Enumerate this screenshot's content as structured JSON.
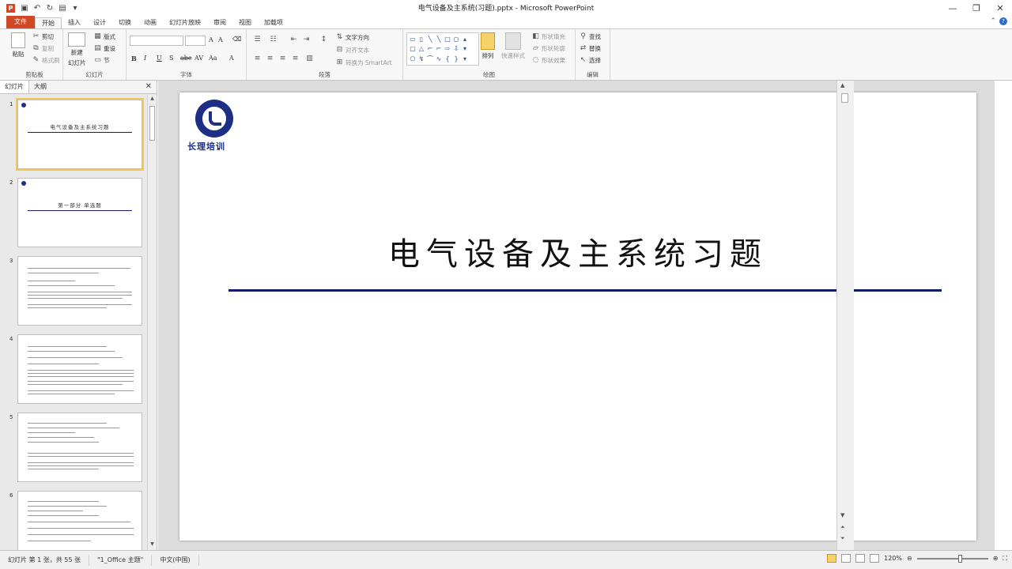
{
  "window": {
    "title": "电气设备及主系统(习题).pptx - Microsoft PowerPoint",
    "app_badge": "P",
    "minimize": "—",
    "restore": "❐",
    "close": "✕"
  },
  "quick_access": [
    "save-icon",
    "undo-icon",
    "redo-icon",
    "new-icon",
    "customize-icon"
  ],
  "tabs": [
    {
      "label": "文件"
    },
    {
      "label": "开始"
    },
    {
      "label": "插入"
    },
    {
      "label": "设计"
    },
    {
      "label": "切换"
    },
    {
      "label": "动画"
    },
    {
      "label": "幻灯片放映"
    },
    {
      "label": "审阅"
    },
    {
      "label": "视图"
    },
    {
      "label": "加载项"
    }
  ],
  "ribbon": {
    "clipboard": {
      "label": "剪贴板",
      "paste": "粘贴",
      "cut": "剪切",
      "copy": "复制",
      "painter": "格式刷"
    },
    "slides": {
      "label": "幻灯片",
      "new_slide": "新建",
      "new_slide2": "幻灯片",
      "layout": "版式",
      "reset": "重设",
      "section": "节"
    },
    "font": {
      "label": "字体",
      "bold": "B",
      "italic": "I",
      "underline": "U",
      "strike": "S",
      "abc": "abc",
      "av": "AV",
      "aa": "Aa",
      "a": "A"
    },
    "paragraph": {
      "label": "段落",
      "text_direction": "文字方向",
      "align_text": "对齐文本",
      "smartart": "转换为 SmartArt"
    },
    "drawing": {
      "label": "绘图",
      "arrange": "排列",
      "quick_styles": "快速样式",
      "fill": "形状填充",
      "outline": "形状轮廓",
      "effects": "形状效果"
    },
    "editing": {
      "label": "编辑",
      "find": "查找",
      "replace": "替换",
      "select": "选择"
    }
  },
  "panel": {
    "tab_slides": "幻灯片",
    "tab_outline": "大纲",
    "close": "✕",
    "thumbnails": [
      {
        "num": "1",
        "title": "电气设备及主系统习题"
      },
      {
        "num": "2",
        "title": "第一部分  单选题"
      },
      {
        "num": "3",
        "title": ""
      },
      {
        "num": "4",
        "title": ""
      },
      {
        "num": "5",
        "title": ""
      },
      {
        "num": "6",
        "title": ""
      }
    ]
  },
  "slide": {
    "logo_text": "长理培训",
    "title": "电气设备及主系统习题"
  },
  "status": {
    "slide_info": "幻灯片 第 1 张，共 55 张",
    "theme": "\"1_Office 主题\"",
    "language": "中文(中国)",
    "zoom": "120%",
    "zoom_percent": 120
  }
}
